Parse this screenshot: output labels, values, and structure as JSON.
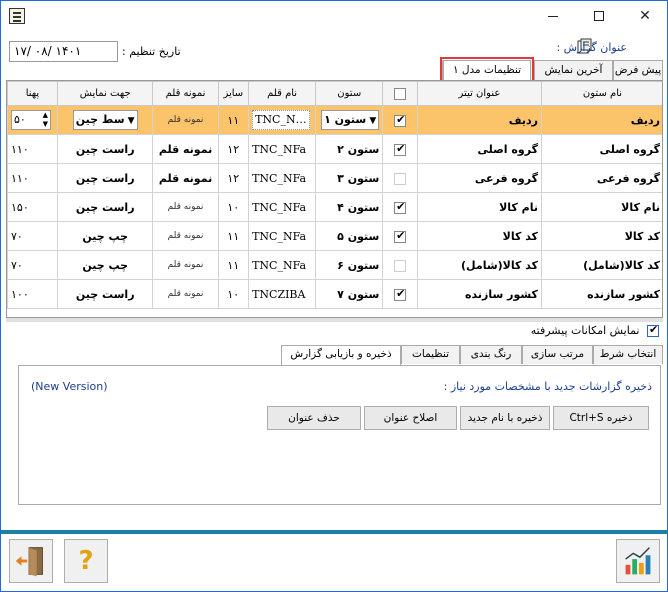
{
  "window": {
    "close_label": "✕"
  },
  "header": {
    "report_title_label": "عنوان گزارش :",
    "date_label": "تاریخ تنظیم :",
    "date_value": "۱۴۰۱ /۰۸ /۱۷"
  },
  "top_tabs": [
    {
      "label": "پیش فرض"
    },
    {
      "label": "آخرین نمایش"
    },
    {
      "label": "تنظیمات مدل ۱"
    }
  ],
  "grid": {
    "headers": [
      "نام ستون",
      "عنوان تیتر",
      "",
      "ستون",
      "نام قلم",
      "سایز",
      "نمونه قلم",
      "جهت نمایش",
      "پهنا"
    ],
    "rows": [
      {
        "row": "ردیف",
        "header": "ردیف",
        "checked": true,
        "column": "ستون ۱",
        "font": "TNC_N",
        "size": "۱۱",
        "sample": "نمونه قلم",
        "align": "سط چین",
        "width": "۵۰",
        "selected": true
      },
      {
        "row": "گروه اصلی",
        "header": "گروه اصلی",
        "checked": true,
        "column": "ستون ۲",
        "font": "TNC_NFa",
        "size": "۱۲",
        "sample": "نمونه قلم",
        "align": "راست چین",
        "width": "۱۱۰",
        "big": true
      },
      {
        "row": "گروه فرعی",
        "header": "گروه فرعی",
        "checked": false,
        "column": "ستون ۳",
        "font": "TNC_NFa",
        "size": "۱۲",
        "sample": "نمونه قلم",
        "align": "راست چین",
        "width": "۱۱۰",
        "big": true
      },
      {
        "row": "نام کالا",
        "header": "نام کالا",
        "checked": true,
        "column": "ستون ۴",
        "font": "TNC_NFa",
        "size": "۱۰",
        "sample": "نمونه قلم",
        "align": "راست چین",
        "width": "۱۵۰"
      },
      {
        "row": "کد کالا",
        "header": "کد کالا",
        "checked": true,
        "column": "ستون ۵",
        "font": "TNC_NFa",
        "size": "۱۱",
        "sample": "نمونه قلم",
        "align": "چپ چین",
        "width": "۷۰"
      },
      {
        "row": "کد کالا(شامل)",
        "header": "کد کالا(شامل)",
        "checked": false,
        "column": "ستون ۶",
        "font": "TNC_NFa",
        "size": "۱۱",
        "sample": "نمونه قلم",
        "align": "چپ چین",
        "width": "۷۰"
      },
      {
        "row": "کشور سازنده",
        "header": "کشور سازنده",
        "checked": true,
        "column": "ستون ۷",
        "font": "TNCZIBA",
        "size": "۱۰",
        "sample": "نمونه قلم",
        "align": "راست چین",
        "width": "۱۰۰"
      }
    ]
  },
  "advanced_label": "نمایش امکانات پیشرفته",
  "lower_tabs": [
    {
      "label": "انتخاب شرط"
    },
    {
      "label": "مرتب سازی"
    },
    {
      "label": "رنگ بندی"
    },
    {
      "label": "تنظیمات"
    },
    {
      "label": "ذخیره و بازیابی گزارش"
    }
  ],
  "panel": {
    "description": "ذخیره گزارشات جدید با مشخصات مورد نیاز :",
    "version": "(New Version)",
    "buttons": [
      {
        "label": "ذخیره     Ctrl+S"
      },
      {
        "label": "ذخیره با نام جدید"
      },
      {
        "label": "اصلاح عنوان"
      },
      {
        "label": "حذف عنوان"
      }
    ]
  },
  "colors": {
    "selected_row": "#fbc36a",
    "accent": "#1c7fa6",
    "tab_highlight": "#e03a3a"
  }
}
